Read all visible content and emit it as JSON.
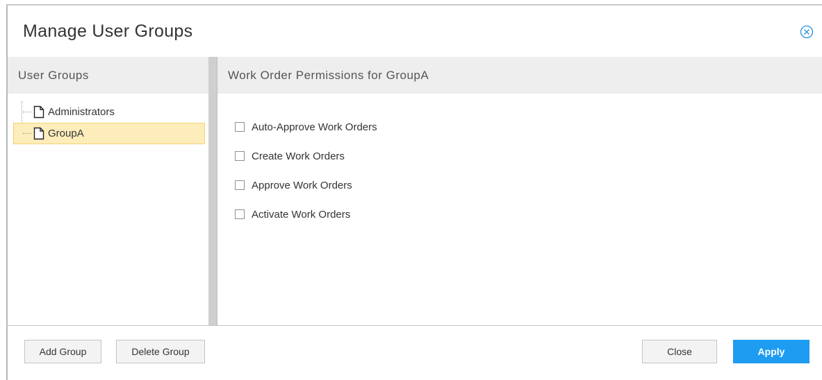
{
  "dialog": {
    "title": "Manage User Groups",
    "close_icon": "close-circle-icon"
  },
  "left_panel": {
    "header": "User Groups",
    "items": [
      {
        "label": "Administrators",
        "icon": "document-icon",
        "selected": false
      },
      {
        "label": "GroupA",
        "icon": "document-icon",
        "selected": true
      }
    ]
  },
  "right_panel": {
    "header": "Work Order Permissions for GroupA",
    "permissions": [
      {
        "label": "Auto-Approve Work Orders",
        "checked": false
      },
      {
        "label": "Create Work Orders",
        "checked": false
      },
      {
        "label": "Approve Work Orders",
        "checked": false
      },
      {
        "label": "Activate Work Orders",
        "checked": false
      }
    ]
  },
  "footer": {
    "add_label": "Add Group",
    "delete_label": "Delete Group",
    "close_label": "Close",
    "apply_label": "Apply"
  },
  "colors": {
    "accent": "#1e9cf2",
    "selection": "#fdedba",
    "header_bg": "#eeeeee"
  }
}
